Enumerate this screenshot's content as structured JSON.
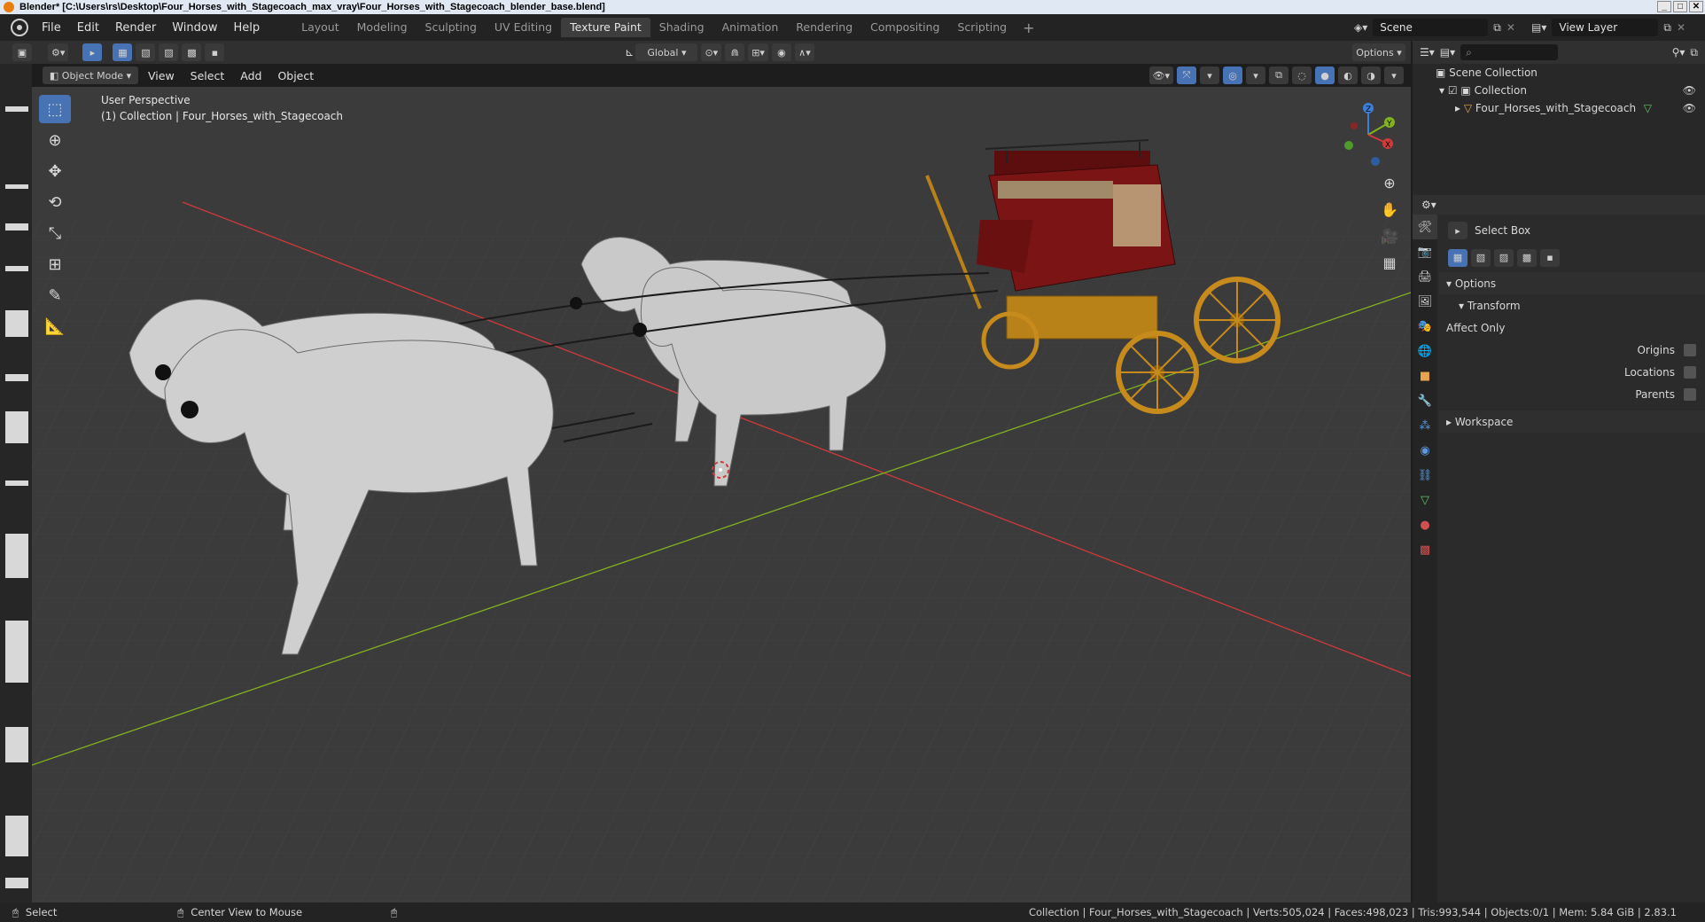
{
  "window": {
    "title": "Blender* [C:\\Users\\rs\\Desktop\\Four_Horses_with_Stagecoach_max_vray\\Four_Horses_with_Stagecoach_blender_base.blend]",
    "buttons": [
      "_",
      "□",
      "✕"
    ]
  },
  "menu": [
    "File",
    "Edit",
    "Render",
    "Window",
    "Help"
  ],
  "workspaces": [
    "Layout",
    "Modeling",
    "Sculpting",
    "UV Editing",
    "Texture Paint",
    "Shading",
    "Animation",
    "Rendering",
    "Compositing",
    "Scripting"
  ],
  "active_workspace": "Texture Paint",
  "scene": {
    "label": "Scene"
  },
  "view_layer": {
    "label": "View Layer"
  },
  "header": {
    "transform_orientation": "Global",
    "options_label": "Options"
  },
  "viewport_header": {
    "mode": "Object Mode",
    "menus": [
      "View",
      "Select",
      "Add",
      "Object"
    ]
  },
  "viewport": {
    "perspective": "User Perspective",
    "collection_info": "(1) Collection | Four_Horses_with_Stagecoach",
    "gizmo": {
      "x_label": "X",
      "y_label": "Y",
      "z_label": "Z"
    }
  },
  "outliner": {
    "search_placeholder": "",
    "items": [
      "Scene Collection",
      "Collection",
      "Four_Horses_with_Stagecoach"
    ]
  },
  "properties": {
    "tool_name": "Select Box",
    "options_label": "Options",
    "transform_label": "Transform",
    "affect_only_label": "Affect Only",
    "origins_label": "Origins",
    "locations_label": "Locations",
    "parents_label": "Parents",
    "workspace_label": "Workspace"
  },
  "status": {
    "select": "Select",
    "center": "Center View to Mouse",
    "stats": "Collection | Four_Horses_with_Stagecoach | Verts:505,024 | Faces:498,023 | Tris:993,544 | Objects:0/1 | Mem: 5.84 GiB | 2.83.1"
  },
  "colors": {
    "accent": "#4772b3",
    "x_axis": "#d13a3a",
    "y_axis": "#82b31f",
    "z_axis": "#3b7fd9",
    "horse": "#c9c9c9",
    "coach_body": "#7b1515",
    "coach_wheels": "#c78a1c"
  }
}
